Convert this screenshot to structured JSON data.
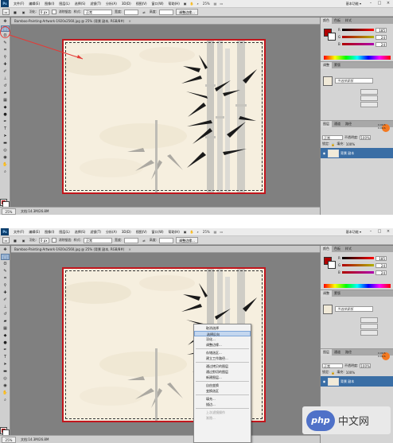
{
  "app": {
    "logo": "Ps",
    "menus": [
      "文件(F)",
      "编辑(E)",
      "图像(I)",
      "图层(L)",
      "选择(S)",
      "滤镜(T)",
      "分析(A)",
      "3D(D)",
      "视图(V)",
      "窗口(W)",
      "帮助(H)"
    ],
    "zoom": "25%",
    "workspace_label": "基本功能 ▾"
  },
  "options": {
    "feather_label": "羽化:",
    "feather_value": "0 px",
    "antialias_label": "消除锯齿",
    "style_label": "样式:",
    "style_value": "正常",
    "width_label": "宽度:",
    "height_label": "高度:",
    "refine_button": "调整边缘..."
  },
  "document": {
    "tab_title": "Bamboo-Painting-Artwork-1920x2560.jpg @ 25% (背景 副本, RGB/8#)",
    "tab_close": "×",
    "status_zoom": "25%",
    "status_doc": "文档:14.3M/26.8M"
  },
  "panels": {
    "color_tabs": [
      "颜色",
      "色板",
      "样式"
    ],
    "color_values": {
      "r": "185",
      "g": "24",
      "b": "24"
    },
    "color_labels": {
      "r": "R",
      "g": "G",
      "b": "B"
    },
    "styles_tabs": [
      "调整",
      "蒙版"
    ],
    "style_name": "不选择蒙版",
    "style_buttons": [
      "",
      "",
      "",
      "",
      ""
    ],
    "layers_tabs": [
      "图层",
      "通道",
      "路径"
    ],
    "blend_label": "正常",
    "opacity_label": "不透明度:",
    "opacity_value": "100%",
    "lock_label": "锁定:",
    "fill_label": "填充:",
    "fill_value": "100%",
    "layer_name": "背景 副本",
    "badge_line1": "0.0K/S",
    "badge_line2": "0.0K/S"
  },
  "context_menu": {
    "items": [
      {
        "label": "取消选择",
        "state": "normal"
      },
      {
        "label": "选择反向",
        "state": "hover"
      },
      {
        "label": "羽化...",
        "state": "normal"
      },
      {
        "label": "调整边缘...",
        "state": "normal"
      },
      {
        "sep": true
      },
      {
        "label": "存储选区...",
        "state": "normal"
      },
      {
        "label": "建立工作路径...",
        "state": "normal"
      },
      {
        "sep": true
      },
      {
        "label": "通过拷贝的图层",
        "state": "normal"
      },
      {
        "label": "通过剪切的图层",
        "state": "normal"
      },
      {
        "label": "新建图层...",
        "state": "normal"
      },
      {
        "sep": true
      },
      {
        "label": "自由变换",
        "state": "normal"
      },
      {
        "label": "变换选区",
        "state": "normal"
      },
      {
        "sep": true
      },
      {
        "label": "填充...",
        "state": "normal"
      },
      {
        "label": "描边...",
        "state": "normal"
      },
      {
        "sep": true
      },
      {
        "label": "上次滤镜操作",
        "state": "dim"
      },
      {
        "label": "渐隐...",
        "state": "dim"
      }
    ]
  },
  "watermark": {
    "logo": "php",
    "text": "中文网"
  },
  "colors": {
    "accent_red": "#c2161d",
    "foreground": "#b00000",
    "layer_selected": "#3a6ea5"
  }
}
